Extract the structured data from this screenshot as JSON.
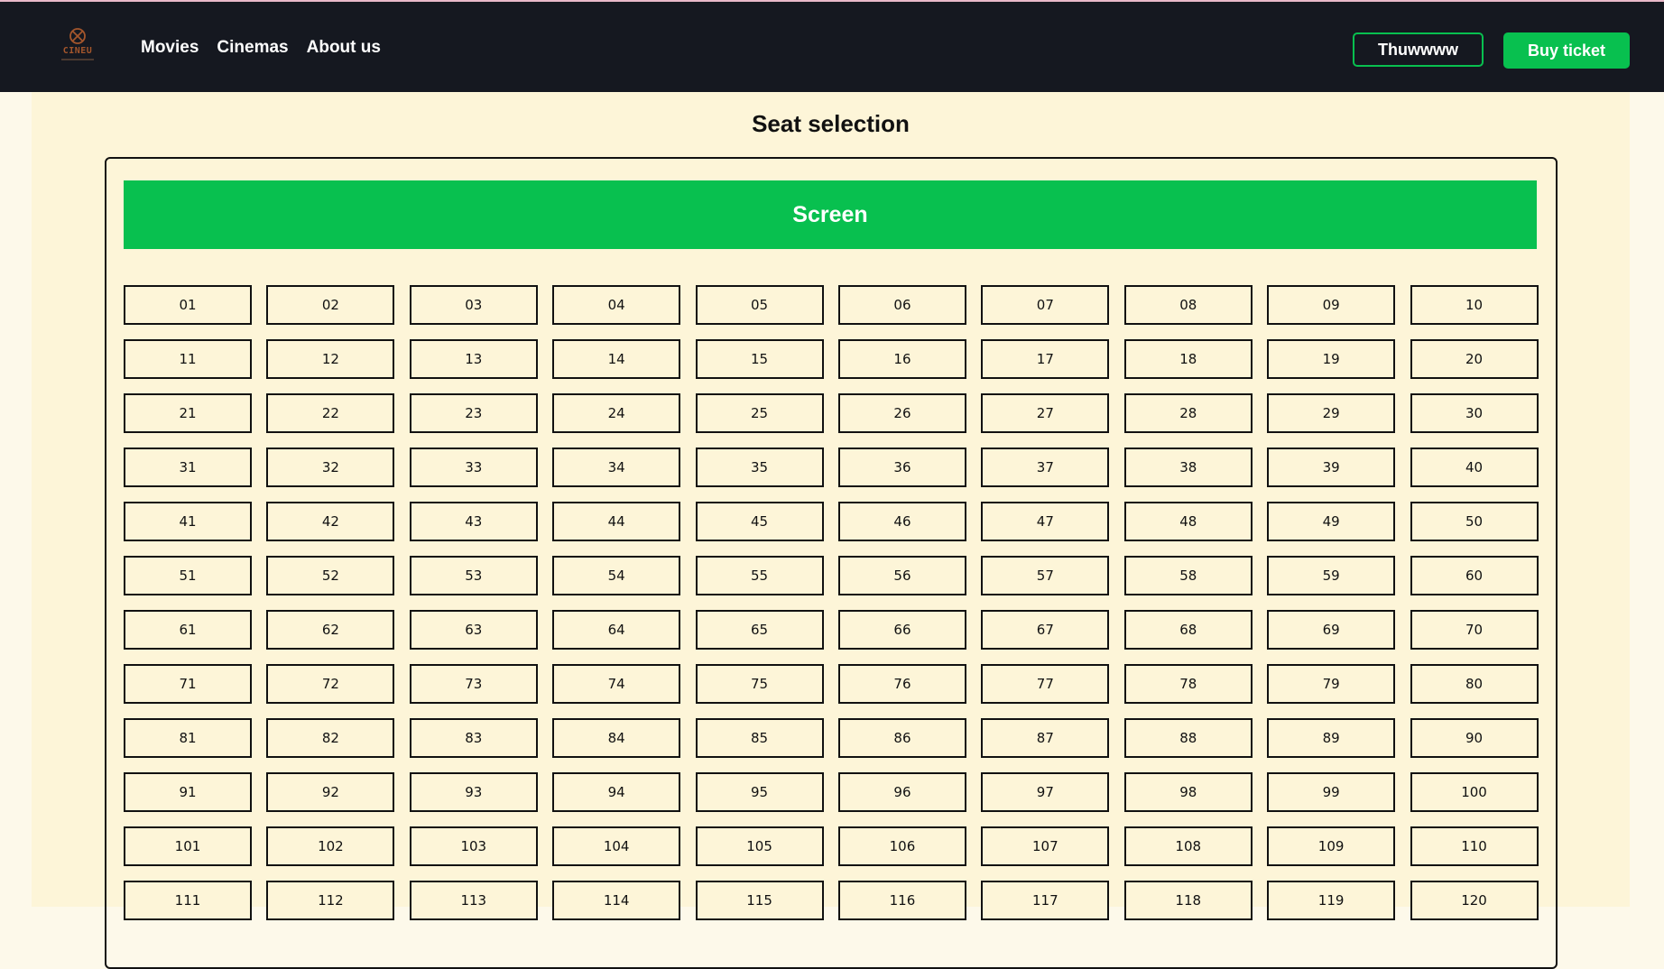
{
  "colors": {
    "navbar_bg": "#151820",
    "accent_green": "#08c04f",
    "page_bg": "#fdf5d8",
    "logo_brown": "#a4562c"
  },
  "header": {
    "logo_text": "CINEU",
    "logo_icon": "film-reel-icon",
    "nav": [
      "Movies",
      "Cinemas",
      "About us"
    ],
    "user_label": "Thuwwww",
    "buy_label": "Buy ticket"
  },
  "main": {
    "title": "Seat selection",
    "screen_label": "Screen",
    "seats": [
      "01",
      "02",
      "03",
      "04",
      "05",
      "06",
      "07",
      "08",
      "09",
      "10",
      "11",
      "12",
      "13",
      "14",
      "15",
      "16",
      "17",
      "18",
      "19",
      "20",
      "21",
      "22",
      "23",
      "24",
      "25",
      "26",
      "27",
      "28",
      "29",
      "30",
      "31",
      "32",
      "33",
      "34",
      "35",
      "36",
      "37",
      "38",
      "39",
      "40",
      "41",
      "42",
      "43",
      "44",
      "45",
      "46",
      "47",
      "48",
      "49",
      "50",
      "51",
      "52",
      "53",
      "54",
      "55",
      "56",
      "57",
      "58",
      "59",
      "60",
      "61",
      "62",
      "63",
      "64",
      "65",
      "66",
      "67",
      "68",
      "69",
      "70",
      "71",
      "72",
      "73",
      "74",
      "75",
      "76",
      "77",
      "78",
      "79",
      "80",
      "81",
      "82",
      "83",
      "84",
      "85",
      "86",
      "87",
      "88",
      "89",
      "90",
      "91",
      "92",
      "93",
      "94",
      "95",
      "96",
      "97",
      "98",
      "99",
      "100",
      "101",
      "102",
      "103",
      "104",
      "105",
      "106",
      "107",
      "108",
      "109",
      "110",
      "111",
      "112",
      "113",
      "114",
      "115",
      "116",
      "117",
      "118",
      "119",
      "120"
    ]
  }
}
